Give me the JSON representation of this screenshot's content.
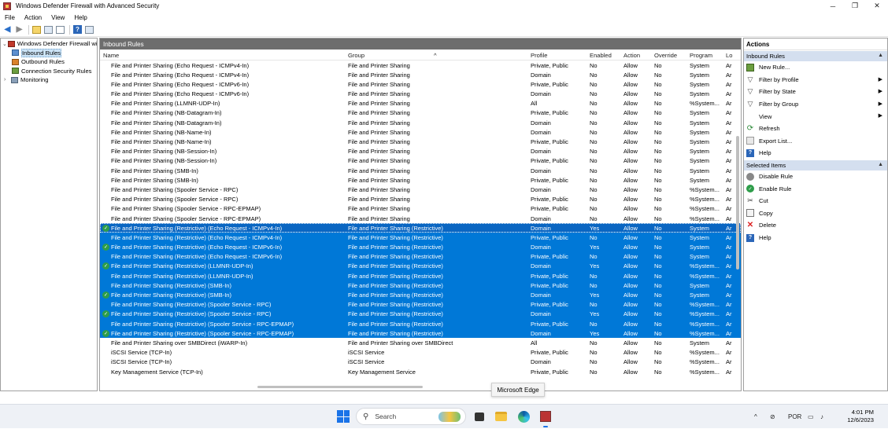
{
  "window": {
    "title": "Windows Defender Firewall with Advanced Security",
    "minimize": "─",
    "maximize": "❐",
    "close": "✕"
  },
  "menu": [
    "File",
    "Action",
    "View",
    "Help"
  ],
  "tree": {
    "root": "Windows Defender Firewall witl",
    "items": [
      "Inbound Rules",
      "Outbound Rules",
      "Connection Security Rules",
      "Monitoring"
    ]
  },
  "center": {
    "header": "Inbound Rules",
    "columns": [
      "Name",
      "Group",
      "Profile",
      "Enabled",
      "Action",
      "Override",
      "Program",
      "Lo"
    ],
    "rows": [
      {
        "name": "File and Printer Sharing (Echo Request - ICMPv4-In)",
        "group": "File and Printer Sharing",
        "profile": "Private, Public",
        "enabled": "No",
        "action": "Allow",
        "override": "No",
        "program": "System",
        "lo": "Ar",
        "sel": false,
        "on": false
      },
      {
        "name": "File and Printer Sharing (Echo Request - ICMPv4-In)",
        "group": "File and Printer Sharing",
        "profile": "Domain",
        "enabled": "No",
        "action": "Allow",
        "override": "No",
        "program": "System",
        "lo": "Ar",
        "sel": false,
        "on": false
      },
      {
        "name": "File and Printer Sharing (Echo Request - ICMPv6-In)",
        "group": "File and Printer Sharing",
        "profile": "Private, Public",
        "enabled": "No",
        "action": "Allow",
        "override": "No",
        "program": "System",
        "lo": "Ar",
        "sel": false,
        "on": false
      },
      {
        "name": "File and Printer Sharing (Echo Request - ICMPv6-In)",
        "group": "File and Printer Sharing",
        "profile": "Domain",
        "enabled": "No",
        "action": "Allow",
        "override": "No",
        "program": "System",
        "lo": "Ar",
        "sel": false,
        "on": false
      },
      {
        "name": "File and Printer Sharing (LLMNR-UDP-In)",
        "group": "File and Printer Sharing",
        "profile": "All",
        "enabled": "No",
        "action": "Allow",
        "override": "No",
        "program": "%System...",
        "lo": "Ar",
        "sel": false,
        "on": false
      },
      {
        "name": "File and Printer Sharing (NB-Datagram-In)",
        "group": "File and Printer Sharing",
        "profile": "Private, Public",
        "enabled": "No",
        "action": "Allow",
        "override": "No",
        "program": "System",
        "lo": "Ar",
        "sel": false,
        "on": false
      },
      {
        "name": "File and Printer Sharing (NB-Datagram-In)",
        "group": "File and Printer Sharing",
        "profile": "Domain",
        "enabled": "No",
        "action": "Allow",
        "override": "No",
        "program": "System",
        "lo": "Ar",
        "sel": false,
        "on": false
      },
      {
        "name": "File and Printer Sharing (NB-Name-In)",
        "group": "File and Printer Sharing",
        "profile": "Domain",
        "enabled": "No",
        "action": "Allow",
        "override": "No",
        "program": "System",
        "lo": "Ar",
        "sel": false,
        "on": false
      },
      {
        "name": "File and Printer Sharing (NB-Name-In)",
        "group": "File and Printer Sharing",
        "profile": "Private, Public",
        "enabled": "No",
        "action": "Allow",
        "override": "No",
        "program": "System",
        "lo": "Ar",
        "sel": false,
        "on": false
      },
      {
        "name": "File and Printer Sharing (NB-Session-In)",
        "group": "File and Printer Sharing",
        "profile": "Domain",
        "enabled": "No",
        "action": "Allow",
        "override": "No",
        "program": "System",
        "lo": "Ar",
        "sel": false,
        "on": false
      },
      {
        "name": "File and Printer Sharing (NB-Session-In)",
        "group": "File and Printer Sharing",
        "profile": "Private, Public",
        "enabled": "No",
        "action": "Allow",
        "override": "No",
        "program": "System",
        "lo": "Ar",
        "sel": false,
        "on": false
      },
      {
        "name": "File and Printer Sharing (SMB-In)",
        "group": "File and Printer Sharing",
        "profile": "Domain",
        "enabled": "No",
        "action": "Allow",
        "override": "No",
        "program": "System",
        "lo": "Ar",
        "sel": false,
        "on": false
      },
      {
        "name": "File and Printer Sharing (SMB-In)",
        "group": "File and Printer Sharing",
        "profile": "Private, Public",
        "enabled": "No",
        "action": "Allow",
        "override": "No",
        "program": "System",
        "lo": "Ar",
        "sel": false,
        "on": false
      },
      {
        "name": "File and Printer Sharing (Spooler Service - RPC)",
        "group": "File and Printer Sharing",
        "profile": "Domain",
        "enabled": "No",
        "action": "Allow",
        "override": "No",
        "program": "%System...",
        "lo": "Ar",
        "sel": false,
        "on": false
      },
      {
        "name": "File and Printer Sharing (Spooler Service - RPC)",
        "group": "File and Printer Sharing",
        "profile": "Private, Public",
        "enabled": "No",
        "action": "Allow",
        "override": "No",
        "program": "%System...",
        "lo": "Ar",
        "sel": false,
        "on": false
      },
      {
        "name": "File and Printer Sharing (Spooler Service - RPC-EPMAP)",
        "group": "File and Printer Sharing",
        "profile": "Private, Public",
        "enabled": "No",
        "action": "Allow",
        "override": "No",
        "program": "%System...",
        "lo": "Ar",
        "sel": false,
        "on": false
      },
      {
        "name": "File and Printer Sharing (Spooler Service - RPC-EPMAP)",
        "group": "File and Printer Sharing",
        "profile": "Domain",
        "enabled": "No",
        "action": "Allow",
        "override": "No",
        "program": "%System...",
        "lo": "Ar",
        "sel": false,
        "on": false
      },
      {
        "name": "File and Printer Sharing (Restrictive) (Echo Request - ICMPv4-In)",
        "group": "File and Printer Sharing (Restrictive)",
        "profile": "Domain",
        "enabled": "Yes",
        "action": "Allow",
        "override": "No",
        "program": "System",
        "lo": "Ar",
        "sel": true,
        "on": true,
        "focus": true
      },
      {
        "name": "File and Printer Sharing (Restrictive) (Echo Request - ICMPv4-In)",
        "group": "File and Printer Sharing (Restrictive)",
        "profile": "Private, Public",
        "enabled": "No",
        "action": "Allow",
        "override": "No",
        "program": "System",
        "lo": "Ar",
        "sel": true,
        "on": false
      },
      {
        "name": "File and Printer Sharing (Restrictive) (Echo Request - ICMPv6-In)",
        "group": "File and Printer Sharing (Restrictive)",
        "profile": "Domain",
        "enabled": "Yes",
        "action": "Allow",
        "override": "No",
        "program": "System",
        "lo": "Ar",
        "sel": true,
        "on": true
      },
      {
        "name": "File and Printer Sharing (Restrictive) (Echo Request - ICMPv6-In)",
        "group": "File and Printer Sharing (Restrictive)",
        "profile": "Private, Public",
        "enabled": "No",
        "action": "Allow",
        "override": "No",
        "program": "System",
        "lo": "Ar",
        "sel": true,
        "on": false
      },
      {
        "name": "File and Printer Sharing (Restrictive) (LLMNR-UDP-In)",
        "group": "File and Printer Sharing (Restrictive)",
        "profile": "Domain",
        "enabled": "Yes",
        "action": "Allow",
        "override": "No",
        "program": "%System...",
        "lo": "Ar",
        "sel": true,
        "on": true
      },
      {
        "name": "File and Printer Sharing (Restrictive) (LLMNR-UDP-In)",
        "group": "File and Printer Sharing (Restrictive)",
        "profile": "Private, Public",
        "enabled": "No",
        "action": "Allow",
        "override": "No",
        "program": "%System...",
        "lo": "Ar",
        "sel": true,
        "on": false
      },
      {
        "name": "File and Printer Sharing (Restrictive) (SMB-In)",
        "group": "File and Printer Sharing (Restrictive)",
        "profile": "Private, Public",
        "enabled": "No",
        "action": "Allow",
        "override": "No",
        "program": "System",
        "lo": "Ar",
        "sel": true,
        "on": false
      },
      {
        "name": "File and Printer Sharing (Restrictive) (SMB-In)",
        "group": "File and Printer Sharing (Restrictive)",
        "profile": "Domain",
        "enabled": "Yes",
        "action": "Allow",
        "override": "No",
        "program": "System",
        "lo": "Ar",
        "sel": true,
        "on": true
      },
      {
        "name": "File and Printer Sharing (Restrictive) (Spooler Service - RPC)",
        "group": "File and Printer Sharing (Restrictive)",
        "profile": "Private, Public",
        "enabled": "No",
        "action": "Allow",
        "override": "No",
        "program": "%System...",
        "lo": "Ar",
        "sel": true,
        "on": false
      },
      {
        "name": "File and Printer Sharing (Restrictive) (Spooler Service - RPC)",
        "group": "File and Printer Sharing (Restrictive)",
        "profile": "Domain",
        "enabled": "Yes",
        "action": "Allow",
        "override": "No",
        "program": "%System...",
        "lo": "Ar",
        "sel": true,
        "on": true
      },
      {
        "name": "File and Printer Sharing (Restrictive) (Spooler Service - RPC-EPMAP)",
        "group": "File and Printer Sharing (Restrictive)",
        "profile": "Private, Public",
        "enabled": "No",
        "action": "Allow",
        "override": "No",
        "program": "%System...",
        "lo": "Ar",
        "sel": true,
        "on": false
      },
      {
        "name": "File and Printer Sharing (Restrictive) (Spooler Service - RPC-EPMAP)",
        "group": "File and Printer Sharing (Restrictive)",
        "profile": "Domain",
        "enabled": "Yes",
        "action": "Allow",
        "override": "No",
        "program": "%System...",
        "lo": "Ar",
        "sel": true,
        "on": true
      },
      {
        "name": "File and Printer Sharing over SMBDirect (iWARP-In)",
        "group": "File and Printer Sharing over SMBDirect",
        "profile": "All",
        "enabled": "No",
        "action": "Allow",
        "override": "No",
        "program": "System",
        "lo": "Ar",
        "sel": false,
        "on": false
      },
      {
        "name": "iSCSI Service (TCP-In)",
        "group": "iSCSI Service",
        "profile": "Private, Public",
        "enabled": "No",
        "action": "Allow",
        "override": "No",
        "program": "%System...",
        "lo": "Ar",
        "sel": false,
        "on": false
      },
      {
        "name": "iSCSI Service (TCP-In)",
        "group": "iSCSI Service",
        "profile": "Domain",
        "enabled": "No",
        "action": "Allow",
        "override": "No",
        "program": "%System...",
        "lo": "Ar",
        "sel": false,
        "on": false
      },
      {
        "name": "Key Management Service (TCP-In)",
        "group": "Key Management Service",
        "profile": "Private, Public",
        "enabled": "No",
        "action": "Allow",
        "override": "No",
        "program": "%System...",
        "lo": "Ar",
        "sel": false,
        "on": false
      }
    ]
  },
  "actions": {
    "title": "Actions",
    "section1": "Inbound Rules",
    "items1": [
      {
        "label": "New Rule...",
        "icon": "new-rule-icon",
        "sub": false
      },
      {
        "label": "Filter by Profile",
        "icon": "filter-icon",
        "sub": true
      },
      {
        "label": "Filter by State",
        "icon": "filter-icon",
        "sub": true
      },
      {
        "label": "Filter by Group",
        "icon": "filter-icon",
        "sub": true
      },
      {
        "label": "View",
        "icon": "",
        "sub": true
      },
      {
        "label": "Refresh",
        "icon": "refresh-icon",
        "sub": false
      },
      {
        "label": "Export List...",
        "icon": "export-icon",
        "sub": false
      },
      {
        "label": "Help",
        "icon": "help-icon",
        "sub": false
      }
    ],
    "section2": "Selected Items",
    "items2": [
      {
        "label": "Disable Rule",
        "icon": "disable-icon"
      },
      {
        "label": "Enable Rule",
        "icon": "enable-icon"
      },
      {
        "label": "Cut",
        "icon": "cut-icon"
      },
      {
        "label": "Copy",
        "icon": "copy-icon"
      },
      {
        "label": "Delete",
        "icon": "delete-icon"
      },
      {
        "label": "Help",
        "icon": "help-icon"
      }
    ]
  },
  "tooltip": "Microsoft Edge",
  "taskbar": {
    "search_placeholder": "Search",
    "language": "POR",
    "time": "4:01 PM",
    "date": "12/6/2023"
  }
}
